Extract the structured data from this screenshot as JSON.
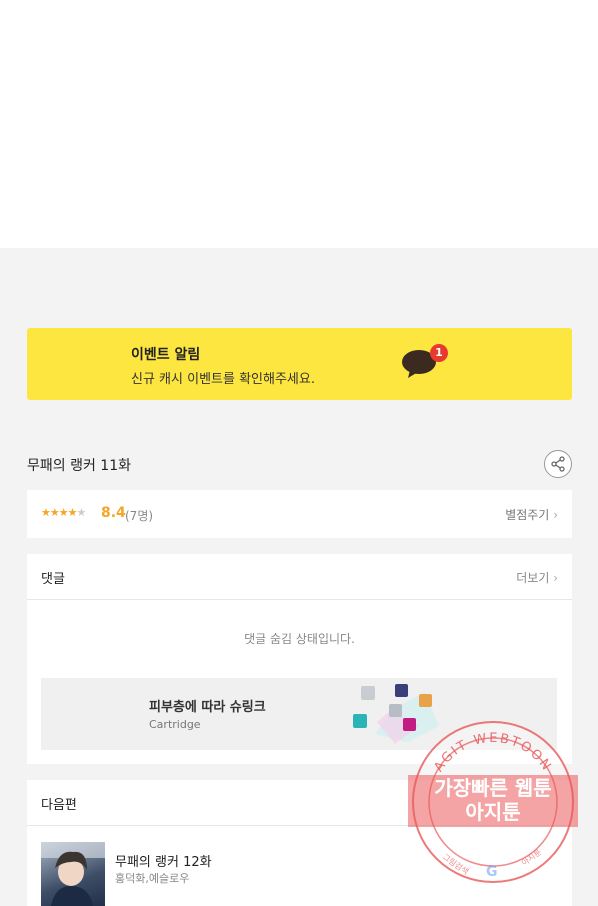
{
  "event": {
    "title": "이벤트 알림",
    "description": "신규 캐시 이벤트를 확인해주세요.",
    "badge": "1",
    "bg_color": "#fde640"
  },
  "episode": {
    "title": "무패의 랭커 11화",
    "share_icon": "share-icon"
  },
  "rating": {
    "stars_filled": "★★★★",
    "stars_empty": "★",
    "score": "8.4",
    "count": "(7명)",
    "rate_label": "별점주기",
    "rate_chevron": "›",
    "score_color": "#f5a623"
  },
  "comments": {
    "title": "댓글",
    "more_label": "더보기",
    "more_chevron": "›",
    "hidden_message": "댓글 숨김 상태입니다."
  },
  "ad": {
    "title": "피부층에 따라 슈링크",
    "subtitle": "Cartridge"
  },
  "next": {
    "title": "다음편",
    "item_title": "무패의 랭커 12화",
    "item_author": "홍덕화,예슬로우"
  },
  "watermark": {
    "line1": "가장빠른 웹툰",
    "line2": "아지툰",
    "arc_top": "AGIT WEBTOON",
    "arc_left": "그림검색",
    "arc_right": "아지툰",
    "color": "#e85a5a"
  }
}
